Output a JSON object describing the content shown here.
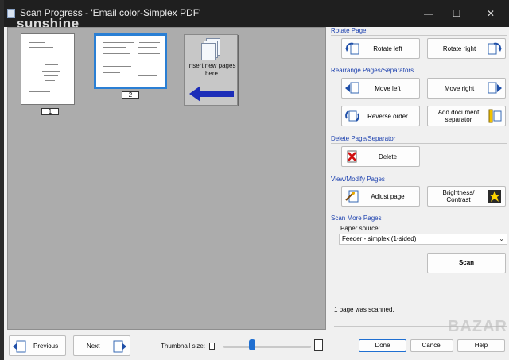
{
  "window": {
    "title": "Scan Progress - 'Email color-Simplex PDF'",
    "watermark": "sunshine",
    "minimize_glyph": "—",
    "maximize_glyph": "☐",
    "close_glyph": "✕"
  },
  "thumbnails": {
    "pages": [
      {
        "number": "1",
        "selected": false
      },
      {
        "number": "2",
        "selected": true
      }
    ],
    "insert_text": "Insert new pages here"
  },
  "panel": {
    "rotate": {
      "header": "Rotate Page",
      "left_label": "Rotate left",
      "right_label": "Rotate right"
    },
    "rearrange": {
      "header": "Rearrange Pages/Separators",
      "move_left": "Move left",
      "move_right": "Move right",
      "reverse": "Reverse order",
      "add_separator": "Add document separator"
    },
    "delete": {
      "header": "Delete Page/Separator",
      "delete_label": "Delete"
    },
    "view": {
      "header": "View/Modify Pages",
      "adjust": "Adjust page",
      "brightness": "Brightness/ Contrast"
    },
    "scan_more": {
      "header": "Scan More Pages",
      "paper_source_label": "Paper source:",
      "paper_source_value": "Feeder - simplex (1-sided)",
      "scan_label": "Scan"
    },
    "status": "1 page was scanned."
  },
  "bottom": {
    "previous": "Previous",
    "next": "Next",
    "thumbnail_size_label": "Thumbnail size:",
    "thumbnail_size_fraction": 0.33,
    "done": "Done",
    "cancel": "Cancel",
    "help": "Help",
    "brand": "BAZAR"
  },
  "colors": {
    "accent": "#1f6fd1",
    "section_header": "#1a3fae",
    "titlebar": "#1f1f1f",
    "thumb_pane": "#acacac"
  }
}
